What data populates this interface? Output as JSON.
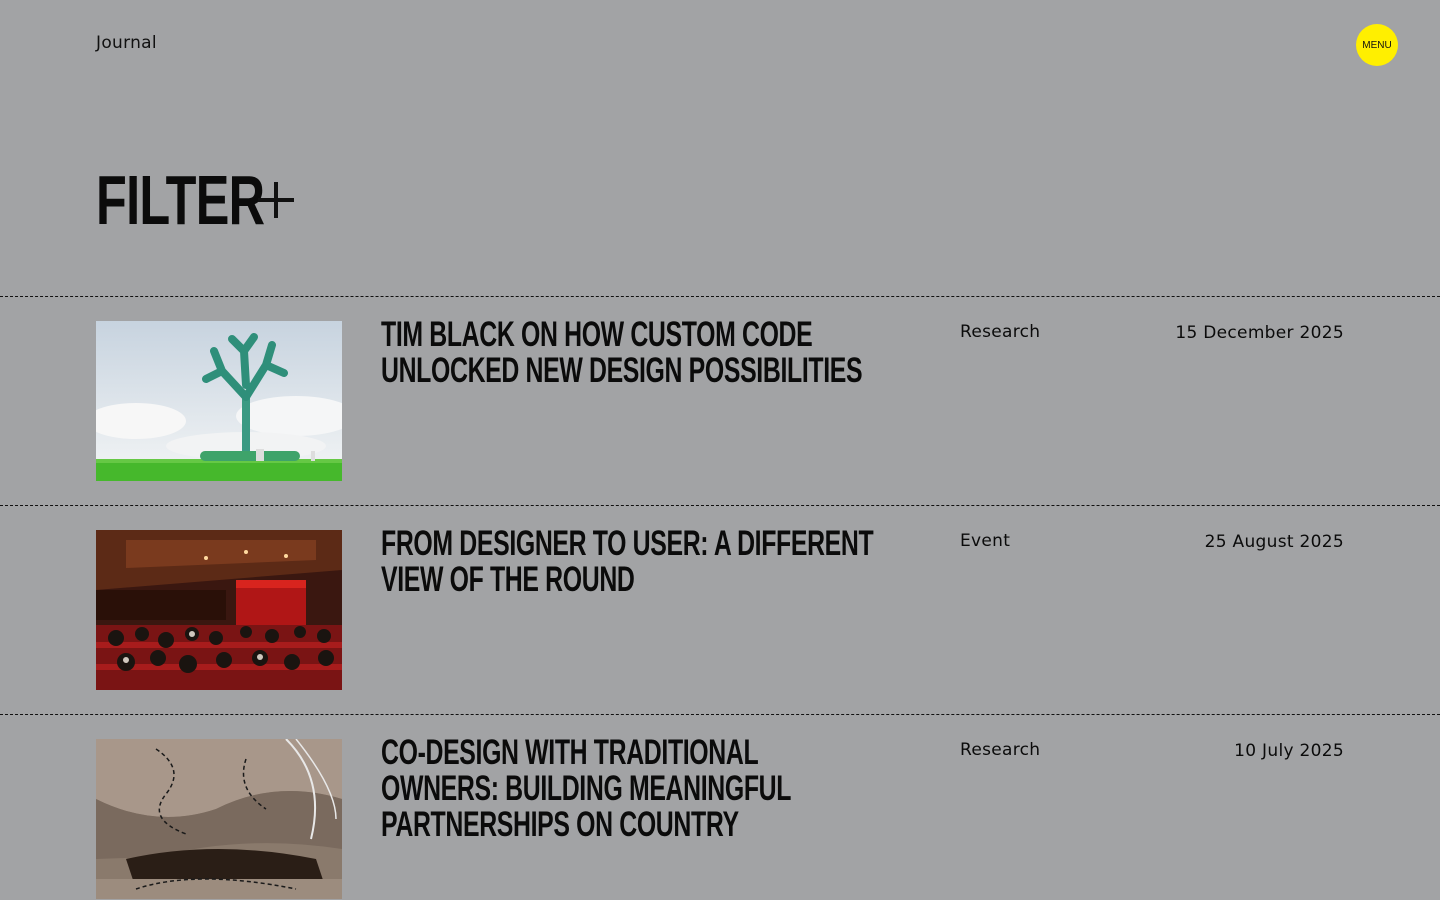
{
  "header": {
    "site_title": "Journal",
    "menu_label": "MENU",
    "menu_color": "#ffef00"
  },
  "filter": {
    "label": "FILTER",
    "icon": "plus-icon"
  },
  "entries": [
    {
      "title": "Tim Black on how custom code unlocked new design possibilities",
      "category": "Research",
      "date": "15 December 2025",
      "image": "tree-sculpture-image"
    },
    {
      "title": "From designer to user: a different view of The Round",
      "category": "Event",
      "date": "25 August 2025",
      "image": "theatre-audience-image"
    },
    {
      "title": "Co-design with Traditional Owners: building meaningful partnerships on Country",
      "category": "Research",
      "date": "10 July 2025",
      "image": "rock-formation-image"
    }
  ],
  "colors": {
    "background": "#a2a3a5",
    "text": "#0b0b0b"
  }
}
